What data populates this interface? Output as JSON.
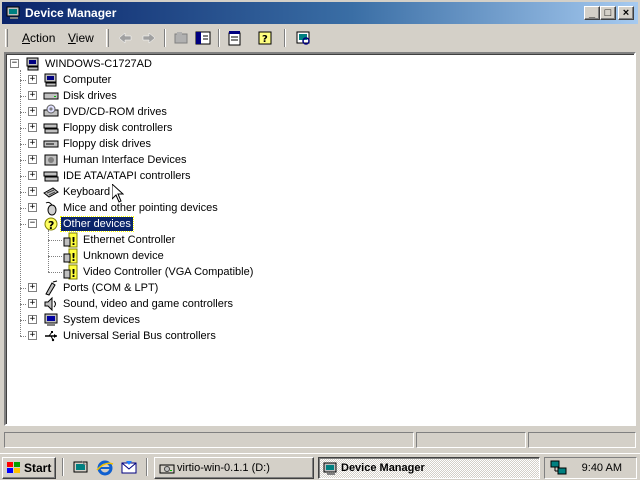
{
  "window": {
    "title": "Device Manager",
    "buttons": {
      "minimize": "_",
      "maximize": "□",
      "close": "×"
    }
  },
  "menu": {
    "action": {
      "label": "Action",
      "mnemonic": "A",
      "rest": "ction"
    },
    "view": {
      "label": "View",
      "mnemonic": "V",
      "rest": "iew"
    }
  },
  "toolbar": {
    "buttons": [
      "back-arrow-icon",
      "forward-arrow-icon",
      "properties-icon",
      "show-hide-tree-icon",
      "properties-sheet-icon",
      "help-icon",
      "scan-hardware-icon"
    ]
  },
  "tree": {
    "root": {
      "label": "WINDOWS-C1727AD",
      "icon": "computer-icon",
      "expanded": true
    },
    "categories": [
      {
        "label": "Computer",
        "icon": "computer-icon",
        "expanded": false
      },
      {
        "label": "Disk drives",
        "icon": "disk-drive-icon",
        "expanded": false
      },
      {
        "label": "DVD/CD-ROM drives",
        "icon": "cdrom-icon",
        "expanded": false
      },
      {
        "label": "Floppy disk controllers",
        "icon": "controller-icon",
        "expanded": false
      },
      {
        "label": "Floppy disk drives",
        "icon": "floppy-drive-icon",
        "expanded": false
      },
      {
        "label": "Human Interface Devices",
        "icon": "hid-icon",
        "expanded": false
      },
      {
        "label": "IDE ATA/ATAPI controllers",
        "icon": "controller-icon",
        "expanded": false
      },
      {
        "label": "Keyboard",
        "icon": "keyboard-icon",
        "expanded": false
      },
      {
        "label": "Mice and other pointing devices",
        "icon": "mouse-icon",
        "expanded": false
      },
      {
        "label": "Other devices",
        "icon": "unknown-device-icon",
        "expanded": true,
        "selected": true
      },
      {
        "label": "Ports (COM & LPT)",
        "icon": "port-icon",
        "expanded": false
      },
      {
        "label": "Sound, video and game controllers",
        "icon": "sound-icon",
        "expanded": false
      },
      {
        "label": "System devices",
        "icon": "system-icon",
        "expanded": false
      },
      {
        "label": "Universal Serial Bus controllers",
        "icon": "usb-icon",
        "expanded": false
      }
    ],
    "other_devices_children": [
      {
        "label": "Ethernet Controller",
        "icon": "warning-device-icon"
      },
      {
        "label": "Unknown device",
        "icon": "warning-device-icon"
      },
      {
        "label": "Video Controller (VGA Compatible)",
        "icon": "warning-device-icon"
      }
    ]
  },
  "taskbar": {
    "start_label": "Start",
    "quick_launch": [
      "show-desktop-icon",
      "internet-explorer-icon",
      "outlook-express-icon"
    ],
    "tasks": [
      {
        "label": "virtio-win-0.1.1 (D:)",
        "icon": "drive-icon",
        "active": false
      },
      {
        "label": "Device Manager",
        "icon": "device-manager-icon",
        "active": true
      }
    ],
    "tray_icons": [
      "network-icon"
    ],
    "clock": "9:40 AM"
  }
}
